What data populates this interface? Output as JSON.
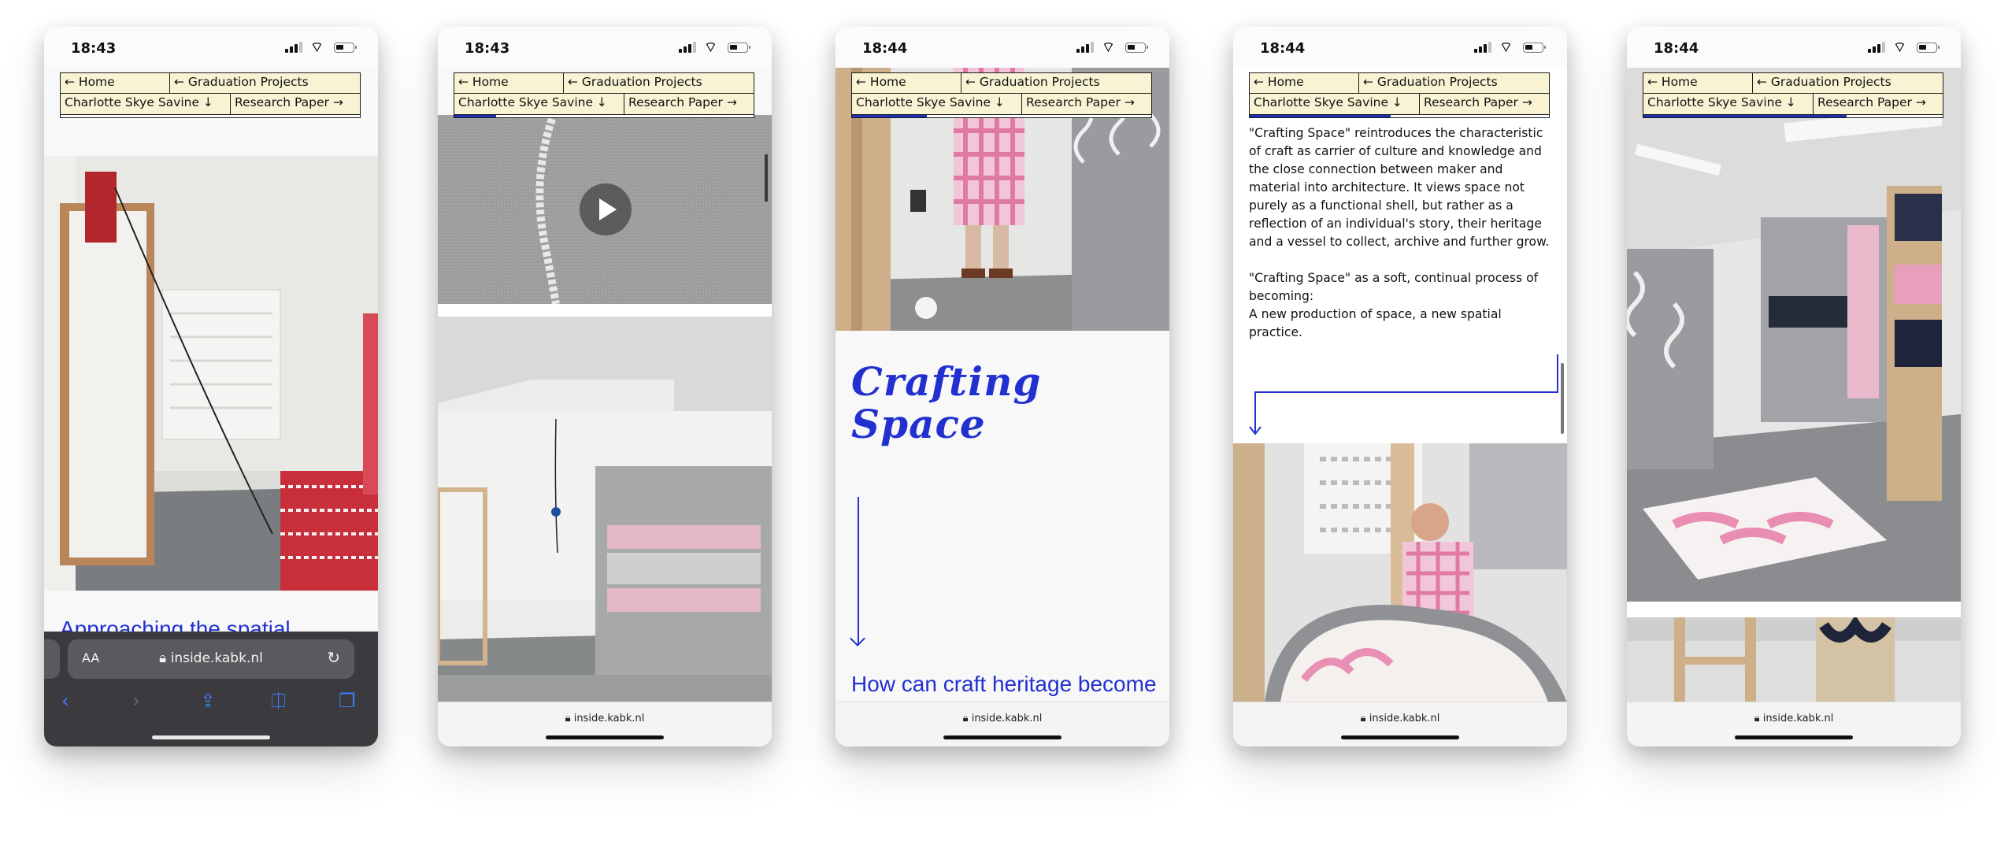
{
  "nav": {
    "home": "← Home",
    "graduation": "← Graduation Projects",
    "author": "Charlotte Skye Savine ↓",
    "research": "Research Paper →"
  },
  "url": "inside.kabk.nl",
  "phones": [
    {
      "time": "18:43",
      "progress": 0.0
    },
    {
      "time": "18:43",
      "progress": 0.14
    },
    {
      "time": "18:44",
      "progress": 0.25
    },
    {
      "time": "18:44",
      "progress": 0.47
    },
    {
      "time": "18:44",
      "progress": 0.68
    }
  ],
  "phone1": {
    "heading": "Approaching the spatial practice as a craft through the",
    "text_size_label": "AA"
  },
  "phone3": {
    "title_line1": "Crafting",
    "title_line2": "Space",
    "question": "How can craft heritage become space? How can process"
  },
  "phone4": {
    "para_top": "\"Crafting Space\" reintroduces the characteristic of craft as carrier of culture and knowledge and the close connection between maker and material into architecture. It views space not purely as a functional shell, but rather as a reflection of an individual's story, their heritage and a vessel to collect, archive and further grow.",
    "para_mid": "\"Crafting Space\" as a soft, continual process of becoming:",
    "para_end": "A new production of space, a new spatial practice."
  },
  "colors": {
    "accent": "#2130cf",
    "nav_bg": "#f8f3d3",
    "progress": "#1c2fb5"
  },
  "icons": [
    "signal-icon",
    "wifi-icon",
    "battery-icon",
    "lock-icon",
    "reload-icon",
    "back-icon",
    "forward-icon",
    "share-icon",
    "bookmarks-icon",
    "tabs-icon",
    "play-icon",
    "arrow-down-icon"
  ]
}
